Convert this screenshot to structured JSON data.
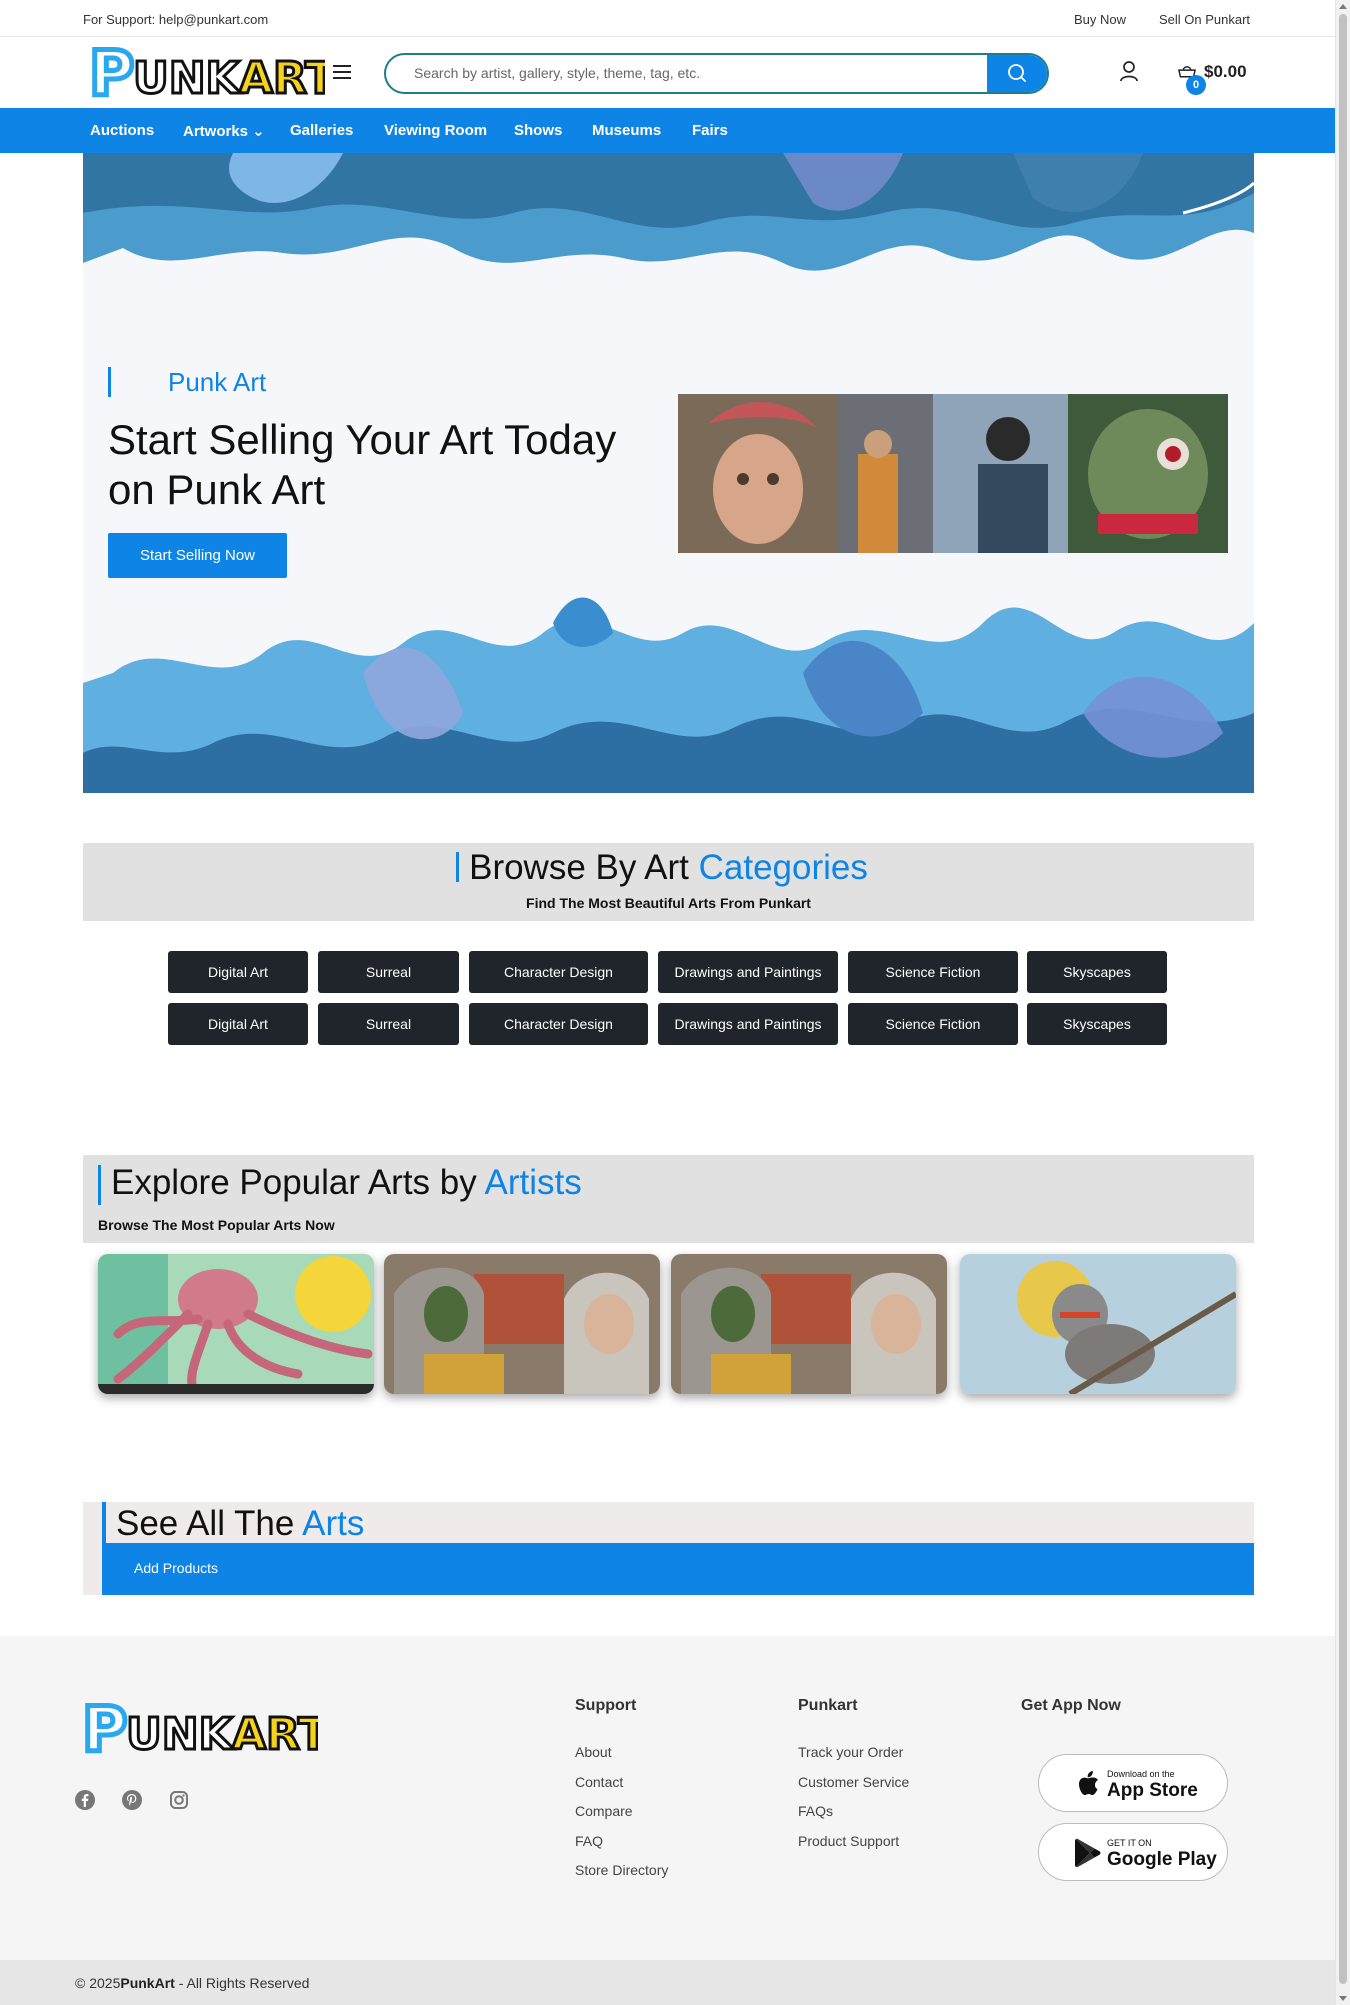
{
  "topbar": {
    "support": "For Support: help@punkart.com",
    "buy_now": "Buy Now",
    "sell_on": "Sell On Punkart"
  },
  "header": {
    "logo_text": "PUNKART",
    "search_placeholder": "Search by artist, gallery, style, theme, tag, etc.",
    "cart_count": "0",
    "cart_total": "$0.00"
  },
  "nav": {
    "items": [
      {
        "label": "Auctions"
      },
      {
        "label": "Artworks ⌄"
      },
      {
        "label": "Galleries"
      },
      {
        "label": "Viewing Room"
      },
      {
        "label": "Shows"
      },
      {
        "label": "Museums"
      },
      {
        "label": "Fairs"
      }
    ]
  },
  "hero": {
    "eyebrow": "Punk Art",
    "title": "Start Selling Your Art Today on Punk Art",
    "cta": "Start Selling Now"
  },
  "categories": {
    "title_main": "Browse By Art ",
    "title_accent": "Categories",
    "subtitle": "Find The Most Beautiful Arts From Punkart",
    "row1": [
      "Digital Art",
      "Surreal",
      "Character Design",
      "Drawings and Paintings",
      "Science Fiction",
      "Skyscapes"
    ],
    "row2": [
      "Digital Art",
      "Surreal",
      "Character Design",
      "Drawings and Paintings",
      "Science Fiction",
      "Skyscapes"
    ]
  },
  "artists": {
    "title_main": "Explore Popular Arts by ",
    "title_accent": "Artists",
    "subtitle": "Browse The Most Popular Arts Now"
  },
  "see_all": {
    "title_main": "See All The ",
    "title_accent": "Arts",
    "tab": "Add Products"
  },
  "footer": {
    "support_title": "Support",
    "support_links": [
      "About",
      "Contact",
      "Compare",
      "FAQ",
      "Store Directory"
    ],
    "punkart_title": "Punkart",
    "punkart_links": [
      "Track your Order",
      "Customer Service",
      "FAQs",
      "Product Support"
    ],
    "app_title": "Get App Now",
    "app_store_small": "Download on the",
    "app_store_big": "App Store",
    "play_small": "GET IT ON",
    "play_big": "Google Play",
    "social_icons": [
      "facebook-icon",
      "pinterest-icon",
      "instagram-icon"
    ]
  },
  "copyright": {
    "prefix": "© 2025",
    "brand": "PunkArt",
    "suffix": " - All Rights Reserved"
  },
  "colors": {
    "accent": "#0d84e6",
    "category_button": "#20252b",
    "logo_blue": "#29a8f0",
    "logo_yellow": "#f5d21c"
  }
}
